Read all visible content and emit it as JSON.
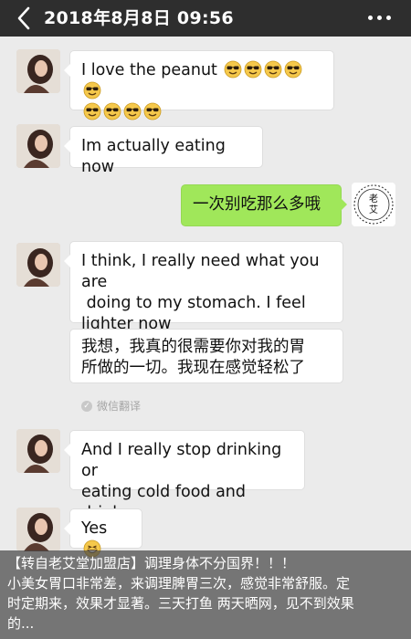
{
  "header": {
    "title": "2018年8月8日 09:56",
    "back_icon": "chevron-left-icon",
    "more_icon": "more-dots-icon"
  },
  "messages": [
    {
      "side": "left",
      "text": "I love the peanut",
      "emoji": "sunglasses-emoji",
      "emoji_count": 9
    },
    {
      "side": "left",
      "text": "Im actually eating now"
    },
    {
      "side": "right",
      "text": "一次别吃那么多哦"
    },
    {
      "side": "left",
      "text_lines": [
        "I think, I really need what you are",
        " doing to my stomach. I feel",
        "lighter now"
      ]
    },
    {
      "side": "left",
      "translation_lines": [
        "我想，我真的很需要你对我的胃",
        "所做的一切。我现在感觉轻松了"
      ],
      "translation_label": "微信翻译"
    },
    {
      "side": "left",
      "text_lines": [
        "And I really stop drinking or",
        "eating cold food and drinks."
      ]
    },
    {
      "side": "left",
      "text": "Yes",
      "emoji": "grin-emoji"
    }
  ],
  "caption": {
    "line1": "【转自老艾堂加盟店】调理身体不分国界！！！",
    "line2": "小美女胃口非常差，来调理脾胃三次，感觉非常舒服。定",
    "line3": "时定期来，效果才显著。三天打鱼 两天晒网，见不到效果",
    "line4": "的..."
  },
  "colors": {
    "header_bg": "#2e2e2e",
    "chat_bg": "#ebebeb",
    "right_bubble": "#a0e75a",
    "left_bubble": "#ffffff"
  }
}
